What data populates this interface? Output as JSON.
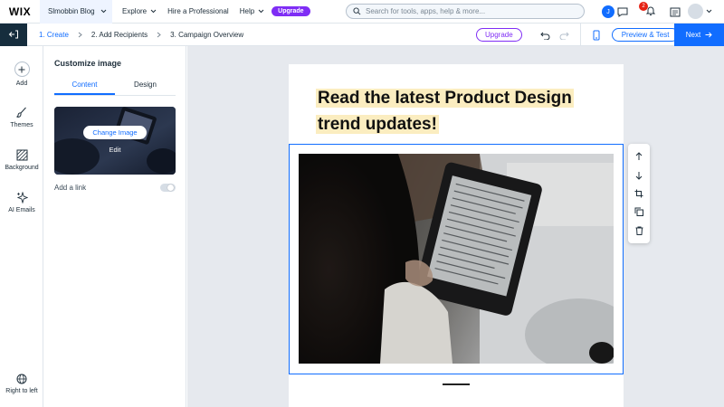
{
  "topbar": {
    "logo": "WIX",
    "site_name": "Slmobbin Blog",
    "nav": [
      "Explore",
      "Hire a Professional",
      "Help"
    ],
    "upgrade": "Upgrade",
    "search_placeholder": "Search for tools, apps, help & more...",
    "avatar_initial": "J",
    "notification_count": "2"
  },
  "steps": {
    "items": [
      "1. Create",
      "2. Add Recipients",
      "3. Campaign Overview"
    ],
    "upgrade": "Upgrade",
    "preview": "Preview & Test",
    "next": "Next"
  },
  "rail": {
    "items": [
      "Add",
      "Themes",
      "Background",
      "AI Emails"
    ],
    "bottom": "Right to left"
  },
  "panel": {
    "title": "Customize image",
    "tabs": [
      "Content",
      "Design"
    ],
    "change_image": "Change Image",
    "edit": "Edit",
    "add_link": "Add a link"
  },
  "email": {
    "headline_line1": "Read the latest Product Design",
    "headline_line2": "trend updates!"
  },
  "colors": {
    "accent": "#116dff",
    "upgrade": "#7f2df5",
    "highlight": "#fbedc0",
    "dark": "#162d3d"
  }
}
